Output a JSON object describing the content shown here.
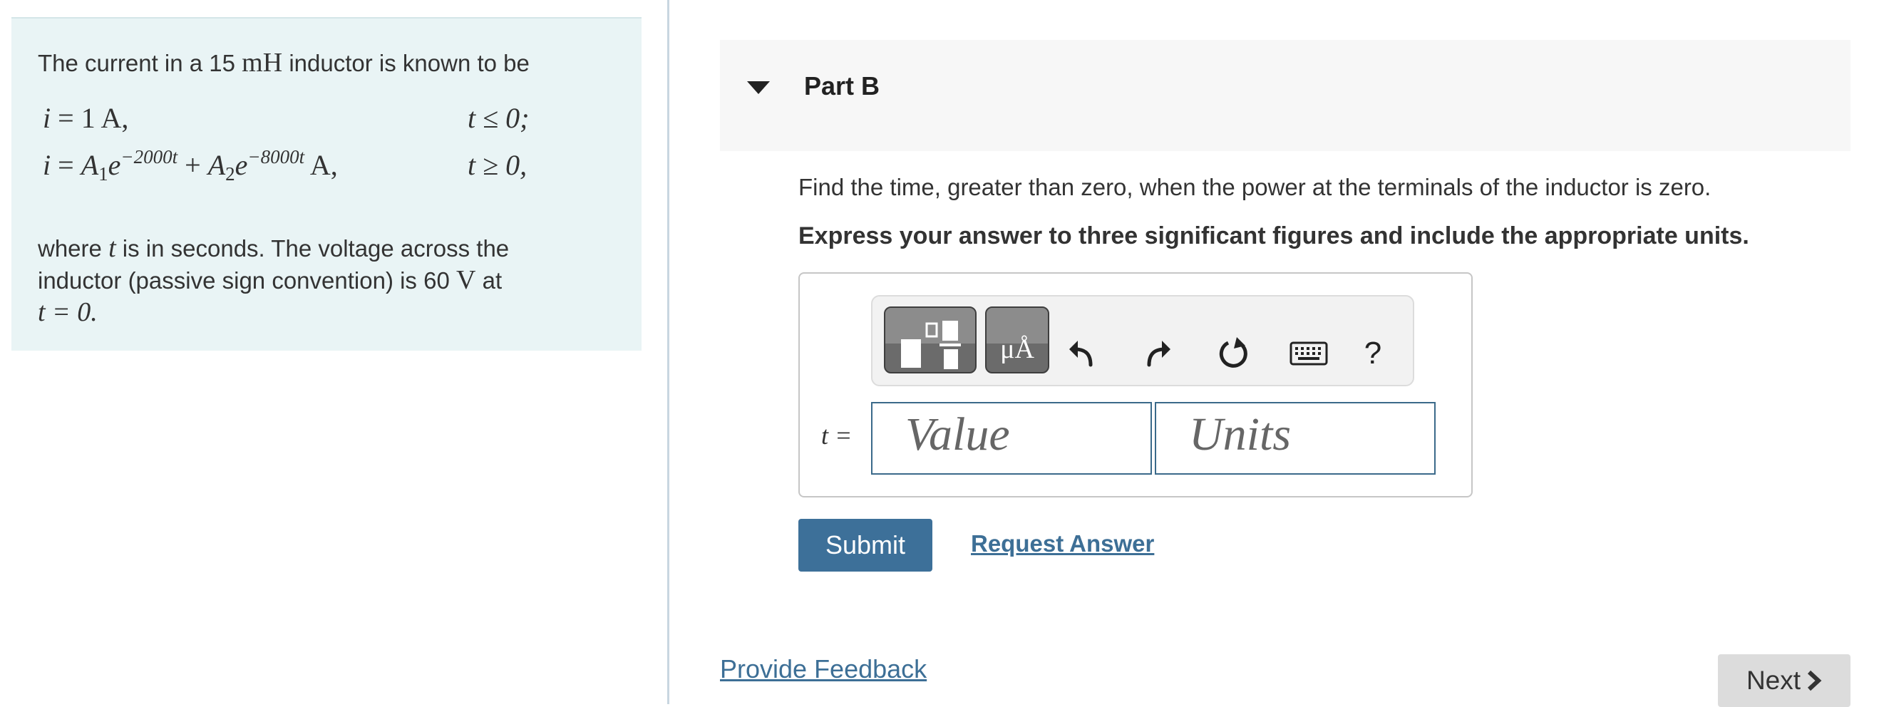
{
  "problem": {
    "intro_before": "The current in a 15",
    "intro_unit": "mH",
    "intro_after": "inductor is known to be",
    "eq1": {
      "lhs": "i",
      "rel": "=",
      "rhs": "1 A,",
      "cond": "t ≤ 0;"
    },
    "eq2": {
      "lhs": "i",
      "rel": "=",
      "a1": "A",
      "sub1": "1",
      "base1": "e",
      "exp1": "−2000t",
      "plus": "+",
      "a2": "A",
      "sub2": "2",
      "base2": "e",
      "exp2": "−8000t",
      "unit": "A,",
      "cond": "t ≥ 0,"
    },
    "desc_1": "where",
    "desc_t": "t",
    "desc_2": "is in seconds. The voltage across the inductor (passive sign convention) is 60",
    "desc_v": "V",
    "desc_3": "at",
    "desc_eq": "t = 0."
  },
  "part": {
    "title": "Part B",
    "question": "Find the time, greater than zero, when the power at the terminals of the inductor is zero.",
    "instruction": "Express your answer to three significant figures and include the appropriate units."
  },
  "toolbar": {
    "template_icon": "fraction-template-icon",
    "units_label": "μÅ",
    "undo_icon": "undo-icon",
    "redo_icon": "redo-icon",
    "reset_icon": "reset-icon",
    "keyboard_icon": "keyboard-icon",
    "help_label": "?"
  },
  "answer": {
    "variable_label": "t =",
    "value_placeholder": "Value",
    "units_placeholder": "Units"
  },
  "actions": {
    "submit_label": "Submit",
    "request_answer_label": "Request Answer",
    "feedback_label": "Provide Feedback",
    "next_label": "Next"
  },
  "colors": {
    "panel_bg": "#e9f4f5",
    "accent": "#3d7099",
    "link": "#3d6f96"
  }
}
